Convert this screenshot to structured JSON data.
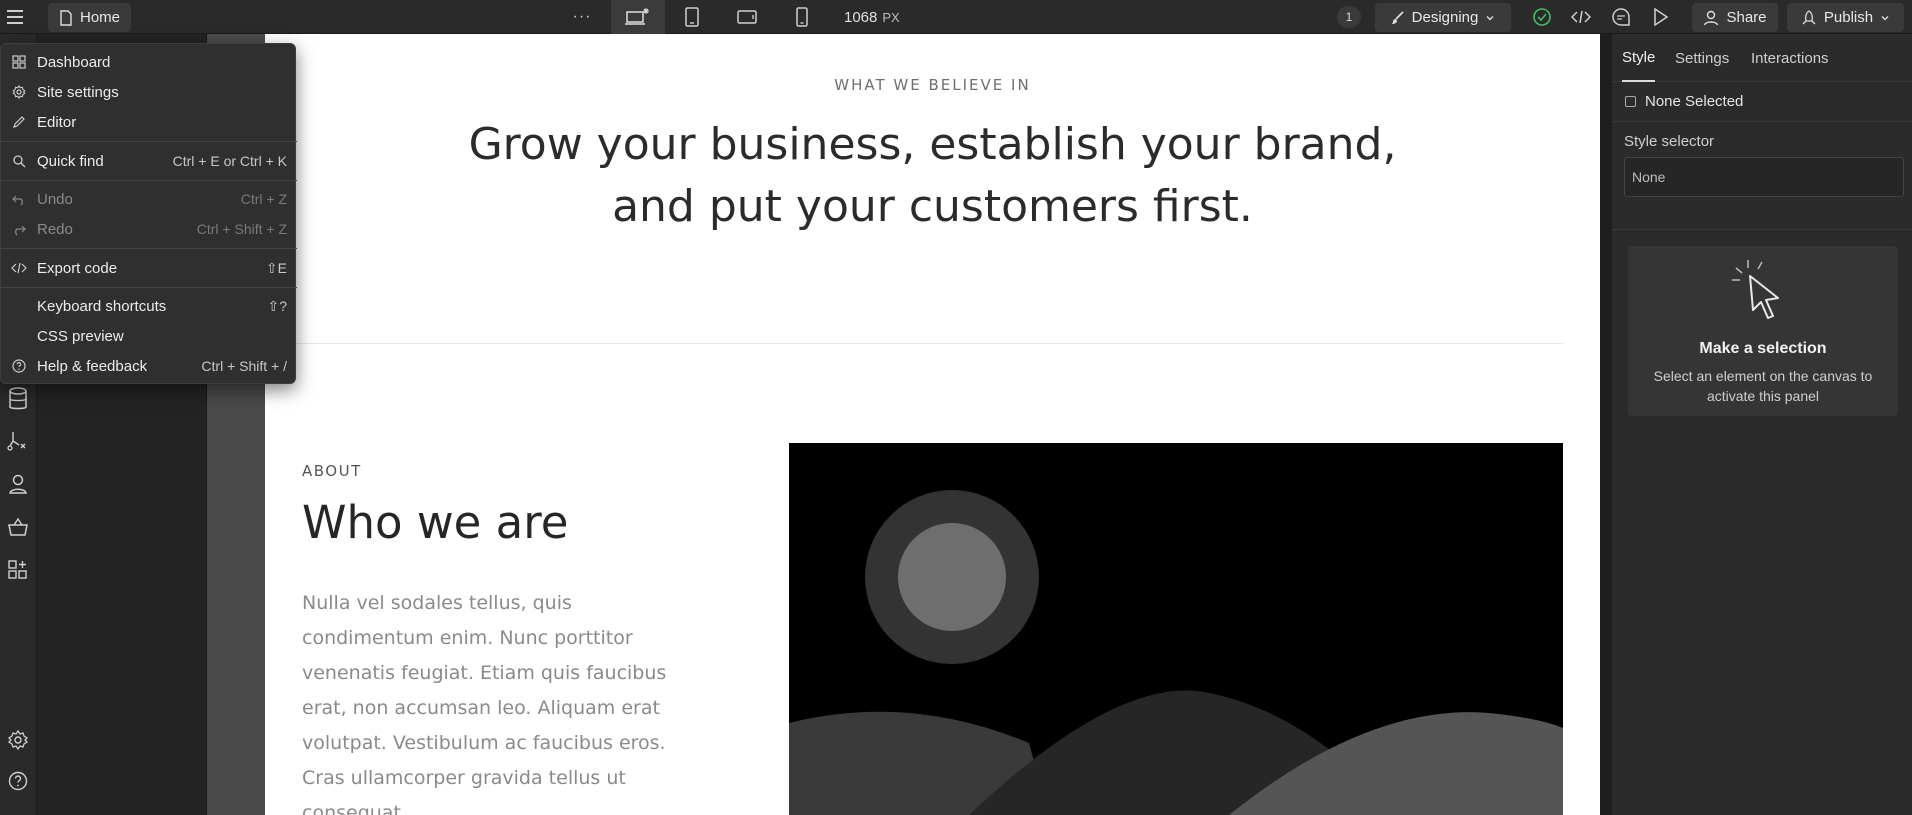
{
  "topbar": {
    "home_label": "Home",
    "more_label": "···",
    "breakpoint_width": "1068",
    "breakpoint_unit": "PX",
    "notification_count": "1",
    "mode_label": "Designing",
    "share_label": "Share",
    "publish_label": "Publish",
    "status_color": "#3fbf6a"
  },
  "menu": {
    "items": [
      {
        "label": "Dashboard",
        "shortcut": "",
        "icon": "grid-icon"
      },
      {
        "label": "Site settings",
        "shortcut": "",
        "icon": "gear-icon"
      },
      {
        "label": "Editor",
        "shortcut": "",
        "icon": "pencil-icon"
      },
      {
        "label": "Quick find",
        "shortcut": "Ctrl + E or Ctrl + K",
        "icon": "search-icon"
      },
      {
        "label": "Undo",
        "shortcut": "Ctrl + Z",
        "icon": "undo-icon"
      },
      {
        "label": "Redo",
        "shortcut": "Ctrl + Shift + Z",
        "icon": "redo-icon"
      },
      {
        "label": "Export code",
        "shortcut": "⇧E",
        "icon": "code-icon"
      },
      {
        "label": "Keyboard shortcuts",
        "shortcut": "⇧?",
        "icon": ""
      },
      {
        "label": "CSS preview",
        "shortcut": "",
        "icon": ""
      },
      {
        "label": "Help & feedback",
        "shortcut": "Ctrl + Shift + /",
        "icon": "help-icon"
      }
    ]
  },
  "canvas": {
    "eyebrow": "WHAT WE BELIEVE IN",
    "headline_line1": "Grow your business, establish your brand,",
    "headline_line2": "and put your customers first.",
    "about_eyebrow": "ABOUT",
    "about_title": "Who we are",
    "about_body": "Nulla vel sodales tellus, quis condimentum enim. Nunc porttitor venenatis feugiat. Etiam quis faucibus erat, non accumsan leo. Aliquam erat volutpat. Vestibulum ac faucibus eros. Cras ullamcorper gravida tellus ut consequat."
  },
  "rightpanel": {
    "tabs": [
      "Style",
      "Settings",
      "Interactions"
    ],
    "none_selected": "None Selected",
    "selector_label": "Style selector",
    "selector_value": "None",
    "empty_title": "Make a selection",
    "empty_desc": "Select an element on the canvas to activate this panel"
  }
}
